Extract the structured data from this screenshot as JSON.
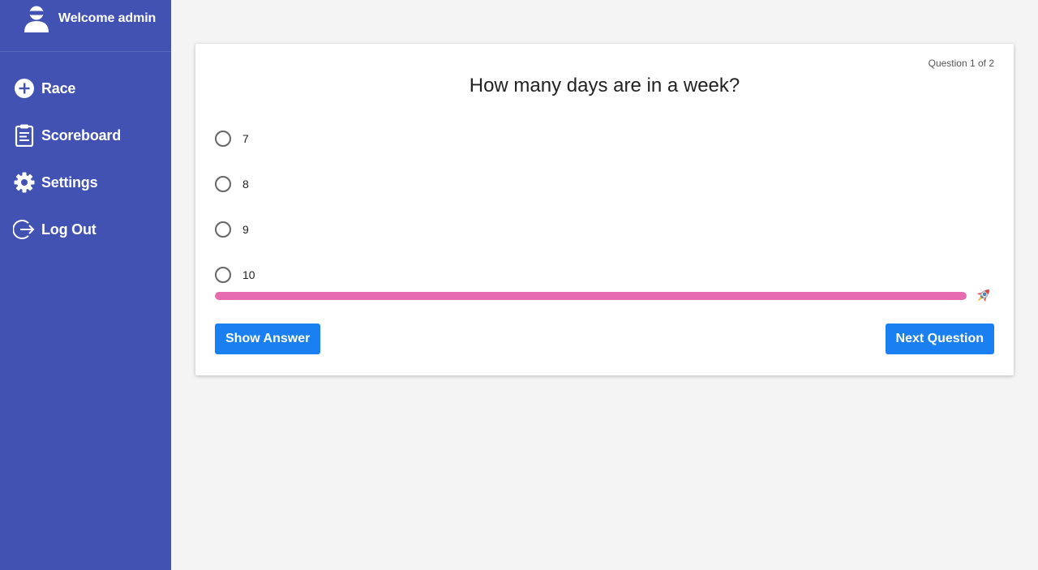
{
  "sidebar": {
    "welcome_text": "Welcome admin",
    "avatar_icon": "user-icon",
    "background": "#4152b3",
    "items": [
      {
        "label": "Race",
        "icon": "plus-circle-icon"
      },
      {
        "label": "Scoreboard",
        "icon": "clipboard-icon"
      },
      {
        "label": "Settings",
        "icon": "gear-icon"
      },
      {
        "label": "Log Out",
        "icon": "logout-icon"
      }
    ]
  },
  "quiz": {
    "counter": "Question 1 of 2",
    "question": "How many days are in a week?",
    "options": [
      "7",
      "8",
      "9",
      "10"
    ],
    "progress_percent": 100,
    "progress_color": "#e66bb0",
    "progress_icon": "rocket-icon",
    "show_answer_label": "Show Answer",
    "next_question_label": "Next Question",
    "button_color": "#1a7ff0"
  }
}
